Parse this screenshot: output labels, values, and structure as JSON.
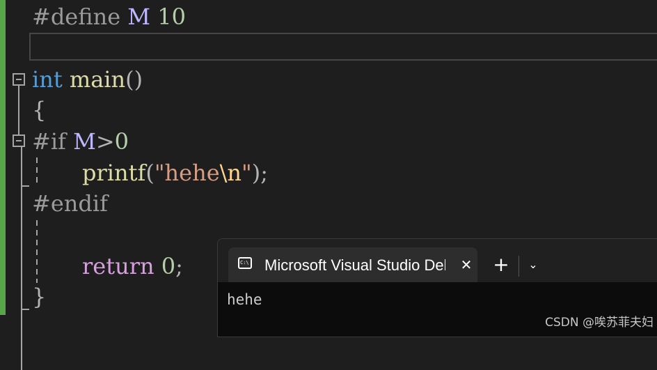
{
  "editor": {
    "lines": {
      "define_directive": "#define",
      "define_name": "M",
      "define_value": "10",
      "main_type": "int",
      "main_name": "main",
      "main_parens": "()",
      "open_brace": "{",
      "if_directive": "#if",
      "if_macro": "M",
      "if_op": ">",
      "if_value": "0",
      "printf_name": "printf",
      "printf_open": "(",
      "printf_string": "\"hehe",
      "printf_escape": "\\n",
      "printf_string_end": "\"",
      "printf_close": ");",
      "endif_directive": "#endif",
      "return_keyword": "return",
      "return_value": "0",
      "return_semicolon": ";",
      "close_brace": "}"
    },
    "colors": {
      "background": "#1e1e1e",
      "change_bar": "#57a64a",
      "keyword": "#569cd6",
      "function": "#dcdcaa",
      "macro": "#beb7ff",
      "string": "#d69d85",
      "control": "#d8a0df"
    }
  },
  "terminal": {
    "tab_title": "Microsoft Visual Studio Debug Console",
    "close_symbol": "✕",
    "new_tab_symbol": "+",
    "dropdown_symbol": "⌄",
    "output": "hehe",
    "colors": {
      "background": "#0c0c0c",
      "tabbar": "#202020",
      "active_tab": "#2d2d2d"
    }
  },
  "watermark": "CSDN @唉苏菲夫妇"
}
